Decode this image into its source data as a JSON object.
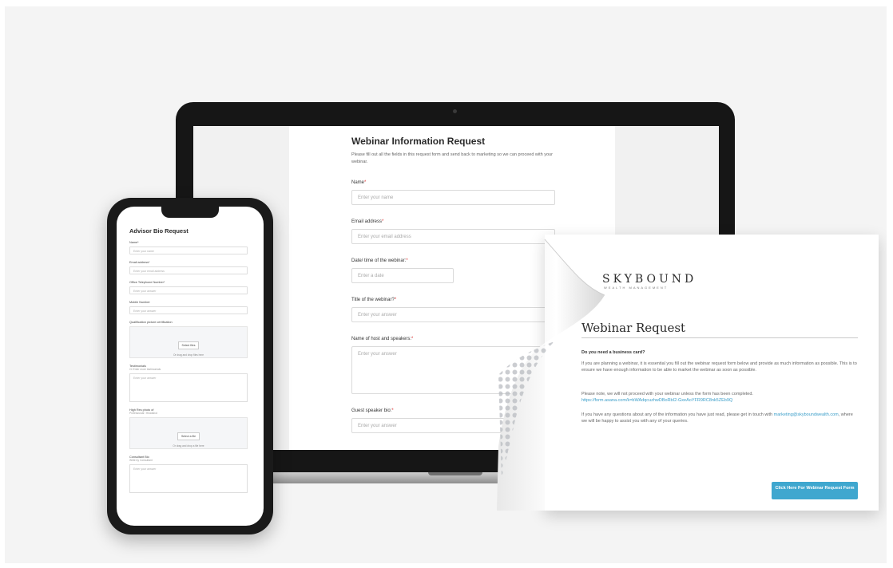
{
  "laptop_form": {
    "title": "Webinar Information Request",
    "description": "Please fill out all the fields in this request form and send back to marketing so we can proceed with your webinar.",
    "required_mark": "*",
    "fields": [
      {
        "label": "Name",
        "placeholder": "Enter your name"
      },
      {
        "label": "Email address",
        "placeholder": "Enter your email address"
      },
      {
        "label": "Date/ time of the webinar:",
        "placeholder": "Enter a date"
      },
      {
        "label": "Title of the webinar?",
        "placeholder": "Enter your answer"
      },
      {
        "label": "Name of host and speakers:",
        "placeholder": "Enter your answer"
      },
      {
        "label": "Guest speaker bio:",
        "placeholder": "Enter your answer"
      }
    ]
  },
  "flyer": {
    "brand": "SKYBOUND",
    "brand_sub": "WEALTH MANAGEMENT",
    "title": "Webinar Request",
    "question": "Do you need a business card?",
    "para1": "If you are planning a webinar, it is essential you fill out the webinar request form below and provide as much information as possible. This is to ensure we have enough information to be able to market the webinar as soon as possible.",
    "para2_text": "Please note, we will not proceed with your webinar unless the form has been completed.",
    "para2_link": "https://form.asana.com/k=bWAdqcuzhwDBoRbI2-GxeAoYFR9RC8nk5ZEb9Q",
    "para3_pre": "If you have any questions about any of the information you have just read, please get in touch with",
    "para3_link": "marketing@skyboundwealth.com",
    "para3_post": ", where we will be happy to assist you with any of your queries.",
    "button_label": "Click Here For Webinar Request Form",
    "accent_color": "#3fa7cf"
  },
  "phone_form": {
    "title": "Advisor Bio Request",
    "fields": [
      {
        "label": "Name*",
        "placeholder": "Enter your name"
      },
      {
        "label": "Email address*",
        "placeholder": "Enter your email address"
      },
      {
        "label": "Office Telephone Number*",
        "placeholder": "Enter your answer"
      },
      {
        "label": "Mobile Number",
        "placeholder": "Enter your answer"
      }
    ],
    "upload1": {
      "label": "Qualification picture certification",
      "button": "Select files",
      "hint": "Or drag and drop files here"
    },
    "testimonials": {
      "label": "Testimonials",
      "hint": "Or Enter more testimonials",
      "placeholder": "Enter your answer"
    },
    "upload2": {
      "label": "High Res photo of",
      "hint": "Professional / Headshot",
      "button": "Select a file",
      "drop_hint": "Or drag and drop a file here"
    },
    "consultant_bio": {
      "label": "Consultant Bio",
      "hint": "Write by Consultant",
      "placeholder": "Enter your answer"
    }
  }
}
